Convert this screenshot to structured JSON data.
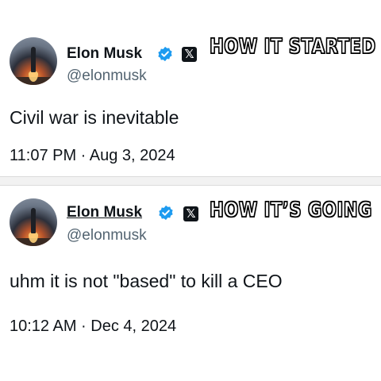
{
  "tweets": [
    {
      "author_name": "Elon Musk",
      "handle": "@elonmusk",
      "text": "Civil war is inevitable",
      "timestamp": "11:07 PM · Aug 3, 2024",
      "caption": "HOW IT STARTED"
    },
    {
      "author_name": "Elon Musk",
      "handle": "@elonmusk",
      "text": "uhm it is not \"based\" to kill a CEO",
      "timestamp": "10:12 AM · Dec 4, 2024",
      "caption": "HOW IT’S GOING"
    }
  ],
  "icons": {
    "verified": "verified-badge-icon",
    "platform": "x-logo-icon"
  },
  "colors": {
    "verified_blue": "#1d9bf0",
    "handle_gray": "#536471",
    "text": "#0f1419"
  }
}
